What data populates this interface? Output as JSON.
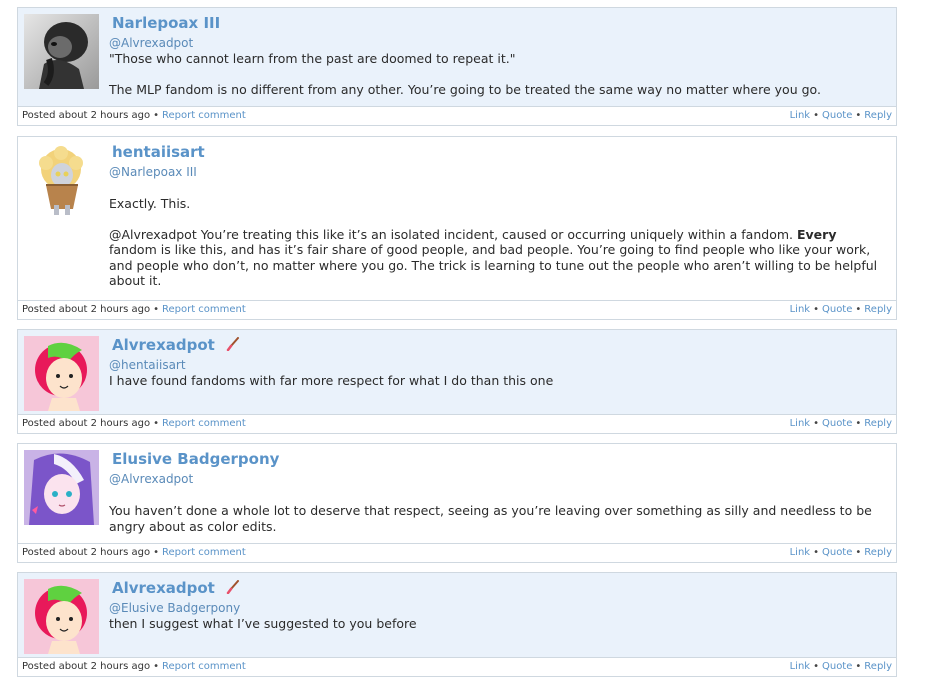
{
  "footer": {
    "posted": "Posted about 2 hours ago",
    "report": "Report comment",
    "link": "Link",
    "quote": "Quote",
    "reply": "Reply",
    "separator": "•"
  },
  "comments": [
    {
      "username": "Narlepoax III",
      "reply_to": "@Alvrexadpot",
      "avatar": "chimp-thinker-avatar",
      "p1": "\"Those who cannot learn from the past are doomed to repeat it.\"",
      "p2": "The MLP fandom is no different from any other. You’re going to be treated the same way no matter where you go."
    },
    {
      "username": "hentaiisart",
      "reply_to": "@Narlepoax III",
      "avatar": "muffin-pony-avatar",
      "p1": "Exactly. This.",
      "p2_a": "@Alvrexadpot You’re treating this like it’s an isolated incident, caused or occurring uniquely within a fandom. ",
      "p2_bold": "Every",
      "p2_b": " fandom is like this, and has it’s fair share of good people, and bad people. You’re going to find people who like your work, and people who don’t, no matter where you go. The trick is learning to tune out the people who aren’t willing to be helpful about it."
    },
    {
      "username": "Alvrexadpot",
      "reply_to": "@hentaiisart",
      "avatar": "green-red-hair-girl-avatar",
      "badge": "paintbrush-icon",
      "p1": "I have found fandoms with far more respect for what I do than this one"
    },
    {
      "username": "Elusive Badgerpony",
      "reply_to": "@Alvrexadpot",
      "avatar": "purple-hair-girl-avatar",
      "p1": "You haven’t done a whole lot to deserve that respect, seeing as you’re leaving over something as silly and needless to be angry about as color edits."
    },
    {
      "username": "Alvrexadpot",
      "reply_to": "@Elusive Badgerpony",
      "avatar": "green-red-hair-girl-avatar",
      "badge": "paintbrush-icon",
      "p1": "then I suggest what I’ve suggested to you before"
    }
  ]
}
